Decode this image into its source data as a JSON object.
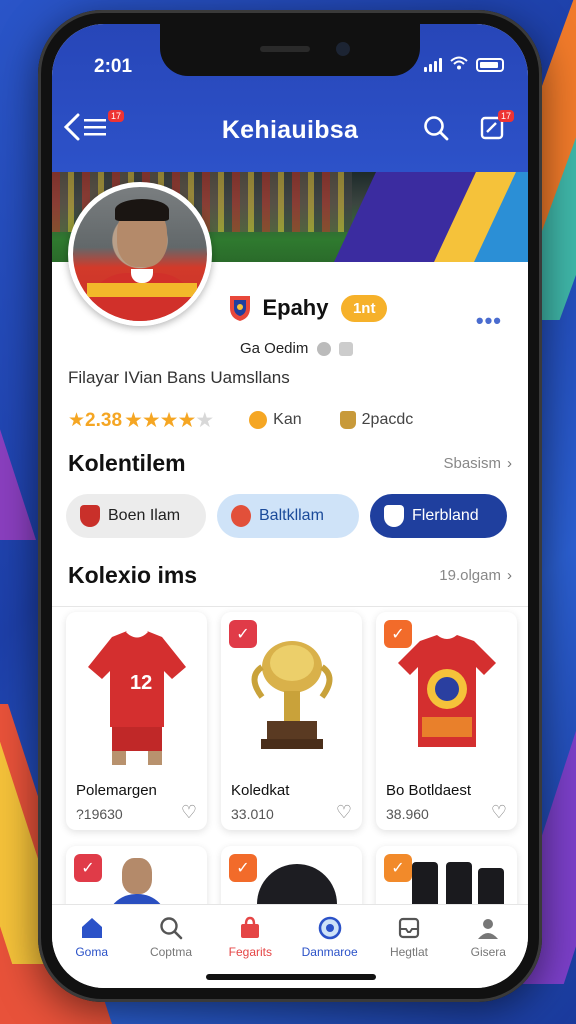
{
  "status": {
    "time": "2:01"
  },
  "header": {
    "title": "Kehiauibsa",
    "menu_badge": "17",
    "share_badge": "17"
  },
  "profile": {
    "name": "Epahy",
    "level": "1nt",
    "handle": "Ga Oedim",
    "bio": "Filayar IVian Bans Uamsllans",
    "rating": "2.38",
    "stat_a": "Kan",
    "stat_b": "2pacdc"
  },
  "collections_section": {
    "title": "Kolentilem",
    "see_all": "Sbasism"
  },
  "chips": [
    {
      "label": "Boen Ilam",
      "icon_color": "#c9302a"
    },
    {
      "label": "Baltkllam",
      "icon_color": "#e2503a"
    },
    {
      "label": "Flerbland",
      "icon_color": "#ffffff"
    }
  ],
  "items_section": {
    "title": "Kolexio ims",
    "see_all": "19.olgam"
  },
  "items": [
    {
      "name": "Polemargen",
      "price": "?19630",
      "check_color": "#ffffff",
      "icon": "jersey-icon"
    },
    {
      "name": "Koledkat",
      "price": "33.010",
      "check_color": "#e03b48",
      "icon": "trophy-icon"
    },
    {
      "name": "Bo Botldaest",
      "price": "38.960",
      "check_color": "#f26b2a",
      "icon": "tshirt-icon"
    },
    {
      "check_color": "#e03b48",
      "icon": "player-icon"
    },
    {
      "check_color": "#f26b2a",
      "icon": "cap-icon"
    },
    {
      "check_color": "#f28a2a",
      "icon": "tracksuit-icon"
    }
  ],
  "tabs": [
    {
      "label": "Goma",
      "icon": "home-icon"
    },
    {
      "label": "Coptma",
      "icon": "search-icon"
    },
    {
      "label": "Fegarits",
      "icon": "bag-icon"
    },
    {
      "label": "Danmaroe",
      "icon": "discover-icon"
    },
    {
      "label": "Hegtlat",
      "icon": "inbox-icon"
    },
    {
      "label": "Gisera",
      "icon": "profile-icon"
    }
  ],
  "colors": {
    "primary": "#2b52c8",
    "accent": "#f5a623"
  }
}
